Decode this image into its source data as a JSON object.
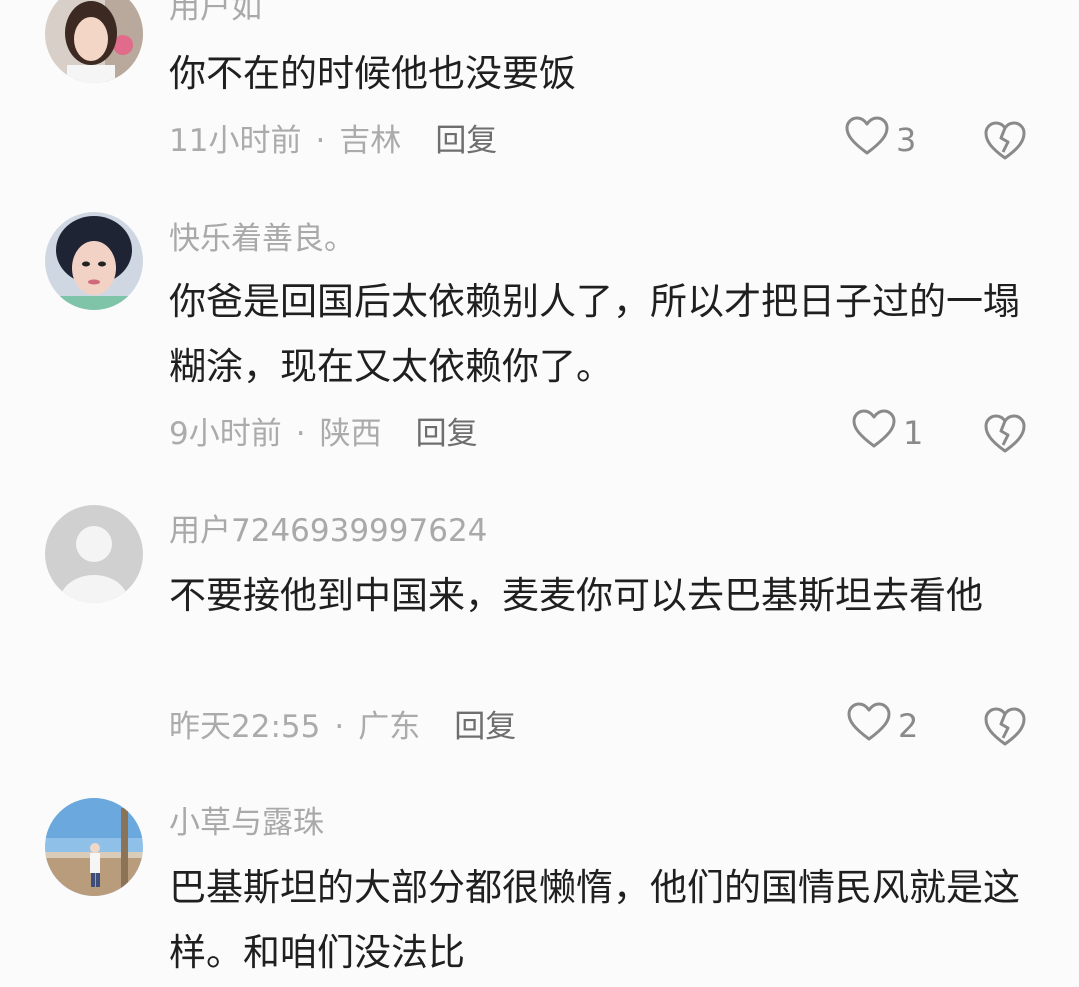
{
  "comments": [
    {
      "username": "用户如",
      "text": "你不在的时候他也没要饭",
      "time": "11小时前",
      "location": "吉林",
      "reply_label": "回复",
      "likes": "3"
    },
    {
      "username": "快乐着善良。",
      "text": "你爸是回国后太依赖别人了，所以才把日子过的一塌糊涂，现在又太依赖你了。",
      "time": "9小时前",
      "location": "陕西",
      "reply_label": "回复",
      "likes": "1"
    },
    {
      "username": "用户7246939997624",
      "text": "不要接他到中国来，麦麦你可以去巴基斯坦去看他",
      "time": "昨天22:55",
      "location": "广东",
      "reply_label": "回复",
      "likes": "2"
    },
    {
      "username": "小草与露珠",
      "text": "巴基斯坦的大部分都很懒惰，他们的国情民风就是这样。和咱们没法比"
    }
  ],
  "separator": "·",
  "icons": {
    "like": "heart-outline-icon",
    "dislike": "broken-heart-icon"
  },
  "colors": {
    "background": "#fbfbfb",
    "text": "#1f1f1f",
    "muted": "#a9a9a9",
    "icon": "#8a8a8a"
  }
}
